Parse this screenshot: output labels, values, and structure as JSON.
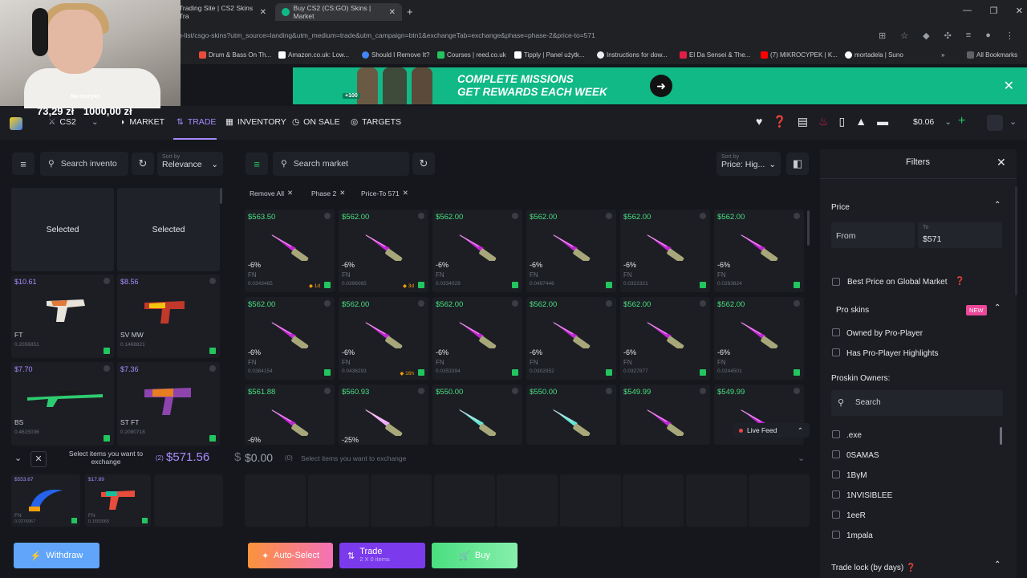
{
  "browser": {
    "tabs": [
      {
        "title": "Trading Site | CS2 Skins Tra"
      },
      {
        "title": "Buy CS2 (CS:GO) Skins | Market"
      }
    ],
    "url": "em-list/csgo-skins?utm_source=landing&utm_medium=trade&utm_campaign=btn1&exchangeTab=exchange&phase=phase-2&price-to=571",
    "bookmarks": [
      "Drum & Bass On Th...",
      "Amazon.co.uk: Low...",
      "Should I Remove It?",
      "Courses | reed.co.uk",
      "Tipply | Panel użytk...",
      "Instructions for dow...",
      "El Da Sensei & The...",
      "(7) MIKROCYPEK | K...",
      "mortadela | Suno"
    ],
    "all_bookmarks": "All Bookmarks"
  },
  "webcam": {
    "label": "Na muzyke"
  },
  "banner": {
    "line1": "COMPLETE MISSIONS",
    "line2": "GET REWARDS EACH WEEK",
    "badge": "+100"
  },
  "balances": {
    "zl1": "73,29 zł",
    "zl2": "1000,00 zł"
  },
  "nav": {
    "game": "CS2",
    "items": [
      "MARKET",
      "TRADE",
      "INVENTORY",
      "ON SALE",
      "TARGETS"
    ],
    "active": "TRADE",
    "wallet": "$0.06",
    "colors": {
      "accent": "#a78bfa",
      "price": "#4ade80"
    }
  },
  "inventory": {
    "search_placeholder": "Search invento",
    "sort_label": "Sort by",
    "sort_value": "Relevance",
    "selected_label": "Selected",
    "items": [
      {
        "price": "$10.61",
        "wear": "FT",
        "float": "0.2056851"
      },
      {
        "price": "$8.56",
        "wear": "SV MW",
        "float": "0.1468821"
      },
      {
        "price": "$7.70",
        "wear": "BS",
        "float": "0.4615036"
      },
      {
        "price": "$7.36",
        "wear": "ST FT",
        "float": "0.2090718"
      }
    ],
    "exchange_hint": "Select items you want to exchange",
    "count": "(2)",
    "total": "$571.56",
    "selected_items": [
      {
        "price": "$553.67",
        "wear": "FN",
        "float": "0.0276967"
      },
      {
        "price": "$17.89",
        "wear": "FN",
        "float": "0.1653065"
      }
    ],
    "withdraw": "Withdraw"
  },
  "market": {
    "search_placeholder": "Search market",
    "sort_label": "Sort by",
    "sort_value": "Price: Hig...",
    "chips": [
      "Remove All",
      "Phase 2",
      "Price-To 571"
    ],
    "rows": [
      [
        {
          "price": "$563.50",
          "disc": "-6%",
          "wear": "FN",
          "float": "0.0343465",
          "badge": "1d"
        },
        {
          "price": "$562.00",
          "disc": "-6%",
          "wear": "FN",
          "float": "0.0396065",
          "badge": "3d"
        },
        {
          "price": "$562.00",
          "disc": "-6%",
          "wear": "FN",
          "float": "0.0334029",
          "badge": ""
        },
        {
          "price": "$562.00",
          "disc": "-6%",
          "wear": "FN",
          "float": "0.0497446",
          "badge": ""
        },
        {
          "price": "$562.00",
          "disc": "-6%",
          "wear": "FN",
          "float": "0.0322321",
          "badge": ""
        },
        {
          "price": "$562.00",
          "disc": "-6%",
          "wear": "FN",
          "float": "0.0283824",
          "badge": ""
        }
      ],
      [
        {
          "price": "$562.00",
          "disc": "-6%",
          "wear": "FN",
          "float": "0.0384154",
          "badge": ""
        },
        {
          "price": "$562.00",
          "disc": "-6%",
          "wear": "FN",
          "float": "0.0436293",
          "badge": "16h"
        },
        {
          "price": "$562.00",
          "disc": "-6%",
          "wear": "FN",
          "float": "0.0353394",
          "badge": ""
        },
        {
          "price": "$562.00",
          "disc": "-6%",
          "wear": "FN",
          "float": "0.0302952",
          "badge": ""
        },
        {
          "price": "$562.00",
          "disc": "-6%",
          "wear": "FN",
          "float": "0.0327877",
          "badge": ""
        },
        {
          "price": "$562.00",
          "disc": "-6%",
          "wear": "FN",
          "float": "0.0244501",
          "badge": ""
        }
      ],
      [
        {
          "price": "$561.88",
          "disc": "-6%"
        },
        {
          "price": "$560.93",
          "disc": "-25%"
        },
        {
          "price": "$550.00",
          "disc": ""
        },
        {
          "price": "$550.00",
          "disc": ""
        },
        {
          "price": "$549.99",
          "disc": ""
        },
        {
          "price": "$549.99",
          "disc": ""
        }
      ]
    ],
    "live_feed": "Live Feed",
    "exchange_total": "$0.00",
    "exchange_count": "(0)",
    "exchange_hint": "Select items you want to exchange",
    "auto_select": "Auto-Select",
    "trade": "Trade",
    "trade_sub": "2 X 0 items",
    "buy": "Buy"
  },
  "filters": {
    "title": "Filters",
    "price": "Price",
    "from": "From",
    "to_label": "To",
    "to_value": "$571",
    "best_price": "Best Price on Global Market",
    "pro_skins": "Pro skins",
    "new_badge": "NEW",
    "owned_by_pro": "Owned by Pro-Player",
    "pro_highlights": "Has Pro-Player Highlights",
    "proskin_owners": "Proskin Owners:",
    "owners_search": "Search",
    "owners": [
      ".exe",
      "0SAMAS",
      "1BγM",
      "1NVISIBLEE",
      "1eeR",
      "1mpala"
    ],
    "trade_lock": "Trade lock (by days)"
  }
}
